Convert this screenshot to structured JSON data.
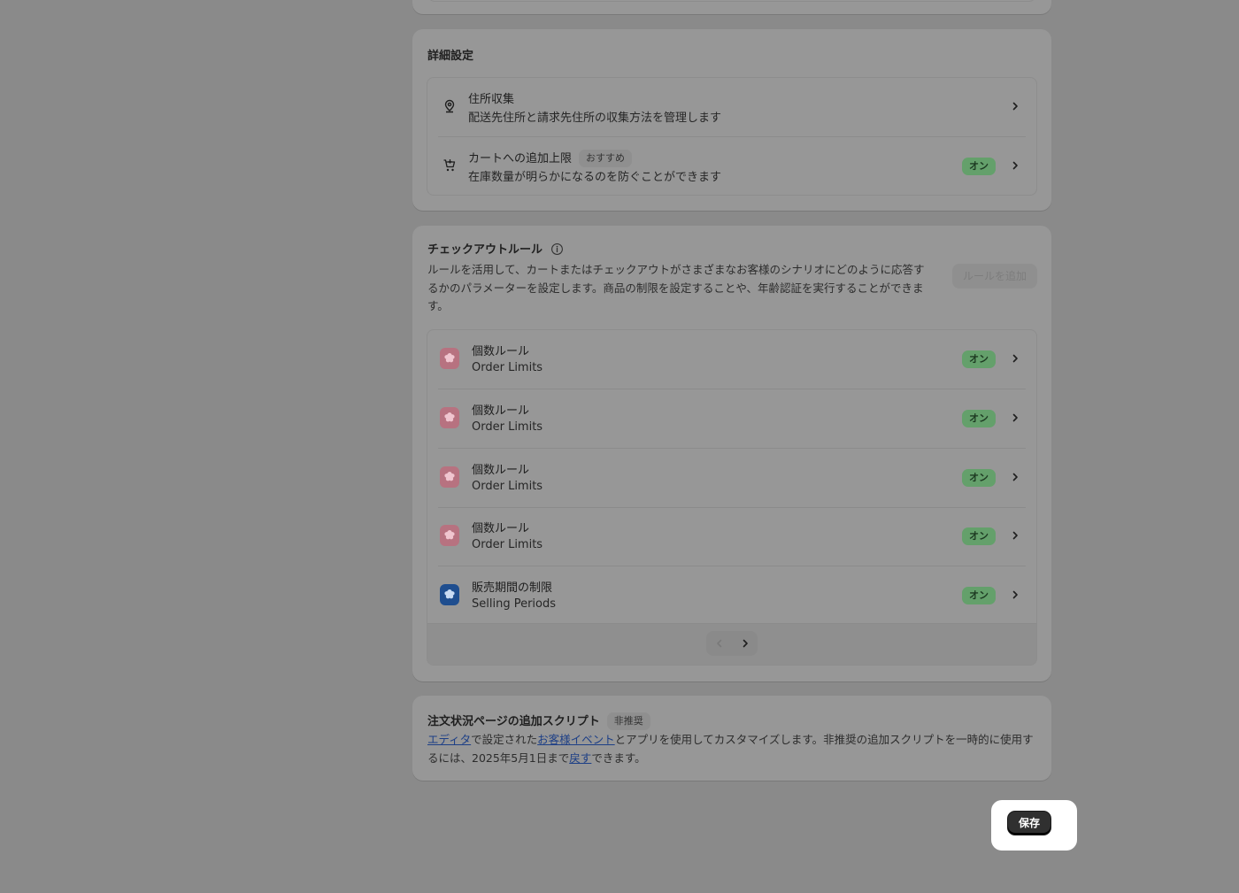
{
  "details": {
    "title": "詳細設定",
    "address": {
      "title": "住所収集",
      "subtitle": "配送先住所と請求先住所の収集方法を管理します",
      "icon": "location-pin-icon"
    },
    "cart_limit": {
      "title": "カートへの追加上限",
      "tag": "おすすめ",
      "subtitle": "在庫数量が明らかになるのを防ぐことができます",
      "status": "オン",
      "icon": "cart-icon"
    }
  },
  "rules": {
    "title": "チェックアウトルール",
    "description": "ルールを活用して、カートまたはチェックアウトがさまざまなお客様のシナリオにどのように応答するかのパラメーターを設定します。商品の制限を設定することや、年齢認証を実行することができます。",
    "add_button": "ルールを追加",
    "items": [
      {
        "title": "個数ルール",
        "subtitle": "Order Limits",
        "status": "オン",
        "icon_color": "#b77280"
      },
      {
        "title": "個数ルール",
        "subtitle": "Order Limits",
        "status": "オン",
        "icon_color": "#b77280"
      },
      {
        "title": "個数ルール",
        "subtitle": "Order Limits",
        "status": "オン",
        "icon_color": "#b77280"
      },
      {
        "title": "個数ルール",
        "subtitle": "Order Limits",
        "status": "オン",
        "icon_color": "#b77280"
      },
      {
        "title": "販売期間の制限",
        "subtitle": "Selling Periods",
        "status": "オン",
        "icon_color": "#1f4e8f"
      }
    ]
  },
  "script": {
    "title": "注文状況ページの追加スクリプト",
    "tag": "非推奨",
    "link_editor": "エディタ",
    "text_1": "で設定された",
    "link_events": "お客様イベント",
    "text_2": "とアプリを使用してカスタマイズします。非推奨の追加スクリプトを一時的に使用するには、2025年5月1日まで",
    "link_revert": "戻す",
    "text_3": "できます。"
  },
  "save_button": "保存",
  "colors": {
    "overlay": "#8a8a8a",
    "status_on": "#64a06b",
    "link": "#1d3f86"
  }
}
